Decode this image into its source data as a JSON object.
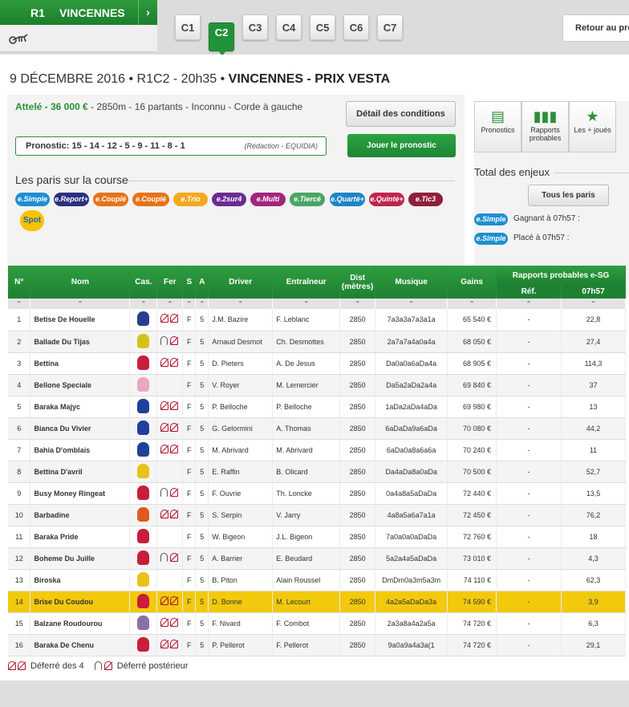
{
  "header": {
    "reunion": "R1",
    "hippodrome": "VINCENNES",
    "arrow": "›",
    "retour": "Retour au pro"
  },
  "course_tabs": [
    "C1",
    "C2",
    "C3",
    "C4",
    "C5",
    "C6",
    "C7"
  ],
  "course_tab_badge": "e.Quinté+",
  "title": {
    "date": "9 DÉCEMBRE 2016 • R1C2 - 20h35 • ",
    "name": "VINCENNES - PRIX VESTA"
  },
  "conditions": {
    "discipline": "Attelé - 36 000 €",
    "rest": " - 2850m - 16 partants  - Inconnu  - Corde à gauche"
  },
  "pronostic": {
    "label": "Pronostic: 15 - 14 - 12 - 5 - 9 - 11 - 8 - 1",
    "source": "(Rédaction - EQUIDIA)"
  },
  "buttons": {
    "detail": "Détail des conditions",
    "jouer": "Jouer le pronostic",
    "tous_paris": "Tous les paris"
  },
  "paris_title": "Les paris sur la course",
  "bets": [
    {
      "label": "e.Simple",
      "color": "#1e8fd0"
    },
    {
      "label": "e.Report+",
      "color": "#2b2f7f"
    },
    {
      "label": "e.Couplé",
      "color": "#e7731a"
    },
    {
      "label": "e.Couplé",
      "color": "#e7731a"
    },
    {
      "label": "e.Trio",
      "color": "#f4a81d"
    },
    {
      "label": "e.2sur4",
      "color": "#6b2c91"
    },
    {
      "label": "e.Multi",
      "color": "#a3267e"
    },
    {
      "label": "e.Tiercé",
      "color": "#4aa564"
    },
    {
      "label": "e.Quarté+",
      "color": "#1d86c7"
    },
    {
      "label": "e.Quinté+",
      "color": "#c0244d"
    },
    {
      "label": "e.Tic3",
      "color": "#8f1f3a"
    }
  ],
  "spot_label": "Spot",
  "right_icons": [
    {
      "label": "Pronostics",
      "icon": "clipboard-icon"
    },
    {
      "label": "Rapports probables",
      "icon": "bar-chart-icon"
    },
    {
      "label": "Les + joués",
      "icon": "stars-person-icon"
    }
  ],
  "enjeux": {
    "title": "Total des enjeux",
    "simple": "e.Simple",
    "gagnant": "Gagnant à 07h57 :",
    "place": "Placé à 07h57 :"
  },
  "table": {
    "headers": {
      "num": "N°",
      "nom": "Nom",
      "cas": "Cas.",
      "fer": "Fer",
      "s": "S",
      "a": "A",
      "driver": "Driver",
      "entraineur": "Entraîneur",
      "dist": "Dist (mètres)",
      "musique": "Musique",
      "gains": "Gains",
      "rapports": "Rapports probables e-SG",
      "ref": "Réf.",
      "time": "07h57"
    },
    "sort_glyph": "⌃",
    "rows": [
      {
        "n": "1",
        "nom": "Betise De Houelle",
        "fer": "D4",
        "s": "F",
        "a": "5",
        "driver": "J.M. Bazire",
        "ent": "F. Leblanc",
        "dist": "2850",
        "mus": "7a3a3a7a3a1a",
        "gains": "65 540 €",
        "ref": "-",
        "rap": "22,8",
        "silk": "#2b3d8f"
      },
      {
        "n": "2",
        "nom": "Ballade Du Tijas",
        "fer": "DP",
        "s": "F",
        "a": "5",
        "driver": "Arnaud Desmot",
        "ent": "Ch. Desmottes",
        "dist": "2850",
        "mus": "2a7a7a4a0a4a",
        "gains": "68 050 €",
        "ref": "-",
        "rap": "27,4",
        "silk": "#d4c21a"
      },
      {
        "n": "3",
        "nom": "Bettina",
        "fer": "D4",
        "s": "F",
        "a": "5",
        "driver": "D. Pieters",
        "ent": "A. De Jesus",
        "dist": "2850",
        "mus": "Da0a0a6aDa4a",
        "gains": "68 905 €",
        "ref": "-",
        "rap": "114,3",
        "silk": "#c81e3c"
      },
      {
        "n": "4",
        "nom": "Bellone Speciale",
        "fer": "",
        "s": "F",
        "a": "5",
        "driver": "V. Royer",
        "ent": "M. Lemercier",
        "dist": "2850",
        "mus": "Da5a2aDa2a4a",
        "gains": "69 840 €",
        "ref": "-",
        "rap": "37",
        "silk": "#e8a8c0"
      },
      {
        "n": "5",
        "nom": "Baraka Majyc",
        "fer": "D4",
        "s": "F",
        "a": "5",
        "driver": "P. Belloche",
        "ent": "P. Belloche",
        "dist": "2850",
        "mus": "1aDa2aDa4aDa",
        "gains": "69 980 €",
        "ref": "-",
        "rap": "13",
        "silk": "#1f3f9a"
      },
      {
        "n": "6",
        "nom": "Bianca Du Vivier",
        "fer": "D4",
        "s": "F",
        "a": "5",
        "driver": "G. Gelormini",
        "ent": "A. Thomas",
        "dist": "2850",
        "mus": "6aDaDa9a6aDa",
        "gains": "70 080 €",
        "ref": "-",
        "rap": "44,2",
        "silk": "#1f3f9a"
      },
      {
        "n": "7",
        "nom": "Bahia D'omblais",
        "fer": "D4",
        "s": "F",
        "a": "5",
        "driver": "M. Abrivard",
        "ent": "M. Abrivard",
        "dist": "2850",
        "mus": "6aDa0a8a6a6a",
        "gains": "70 240 €",
        "ref": "-",
        "rap": "11",
        "silk": "#1f3f9a"
      },
      {
        "n": "8",
        "nom": "Bettina D'avril",
        "fer": "",
        "s": "F",
        "a": "5",
        "driver": "E. Raffin",
        "ent": "B. Olicard",
        "dist": "2850",
        "mus": "Da4aDa8a0aDa",
        "gains": "70 500 €",
        "ref": "-",
        "rap": "52,7",
        "silk": "#e8c21a"
      },
      {
        "n": "9",
        "nom": "Busy Money Ringeat",
        "fer": "DP",
        "s": "F",
        "a": "5",
        "driver": "F. Ouvrie",
        "ent": "Th. Loncke",
        "dist": "2850",
        "mus": "0a4a8a5aDaDa",
        "gains": "72 440 €",
        "ref": "-",
        "rap": "13,5",
        "silk": "#c81e3c"
      },
      {
        "n": "10",
        "nom": "Barbadine",
        "fer": "D4",
        "s": "F",
        "a": "5",
        "driver": "S. Serpin",
        "ent": "V. Jarry",
        "dist": "2850",
        "mus": "4a8a5a6a7a1a",
        "gains": "72 450 €",
        "ref": "-",
        "rap": "76,2",
        "silk": "#e05a1e"
      },
      {
        "n": "11",
        "nom": "Baraka Pride",
        "fer": "",
        "s": "F",
        "a": "5",
        "driver": "W. Bigeon",
        "ent": "J.L. Bigeon",
        "dist": "2850",
        "mus": "7a0a0a0aDaDa",
        "gains": "72 760 €",
        "ref": "-",
        "rap": "18",
        "silk": "#c81e3c"
      },
      {
        "n": "12",
        "nom": "Boheme Du Juille",
        "fer": "DP",
        "s": "F",
        "a": "5",
        "driver": "A. Barrier",
        "ent": "E. Beudard",
        "dist": "2850",
        "mus": "5a2a4a5aDaDa",
        "gains": "73 010 €",
        "ref": "-",
        "rap": "4,3",
        "silk": "#c81e3c"
      },
      {
        "n": "13",
        "nom": "Biroska",
        "fer": "",
        "s": "F",
        "a": "5",
        "driver": "B. Piton",
        "ent": "Alain Roussel",
        "dist": "2850",
        "mus": "DmDm0a3m5a3m",
        "gains": "74 110 €",
        "ref": "-",
        "rap": "62,3",
        "silk": "#e8c21a"
      },
      {
        "n": "14",
        "nom": "Brise Du Coudou",
        "fer": "D4",
        "s": "F",
        "a": "5",
        "driver": "D. Bonne",
        "ent": "M. Lecourt",
        "dist": "2850",
        "mus": "4a2a5aDaDa3a",
        "gains": "74 590 €",
        "ref": "-",
        "rap": "3,9",
        "silk": "#c81e3c",
        "hl": true
      },
      {
        "n": "15",
        "nom": "Balzane Roudourou",
        "fer": "D4",
        "s": "F",
        "a": "5",
        "driver": "F. Nivard",
        "ent": "F. Combot",
        "dist": "2850",
        "mus": "2a3a8a4a2a5a",
        "gains": "74 720 €",
        "ref": "-",
        "rap": "6,3",
        "silk": "#8a6fa8"
      },
      {
        "n": "16",
        "nom": "Baraka De Chenu",
        "fer": "D4",
        "s": "F",
        "a": "5",
        "driver": "P. Pellerot",
        "ent": "F. Pellerot",
        "dist": "2850",
        "mus": "9a0a9a4a3a(1",
        "gains": "74 720 €",
        "ref": "-",
        "rap": "29,1",
        "silk": "#c81e3c"
      }
    ]
  },
  "legend": {
    "d4": "Déferré des 4",
    "dp": "Déferré postérieur"
  }
}
